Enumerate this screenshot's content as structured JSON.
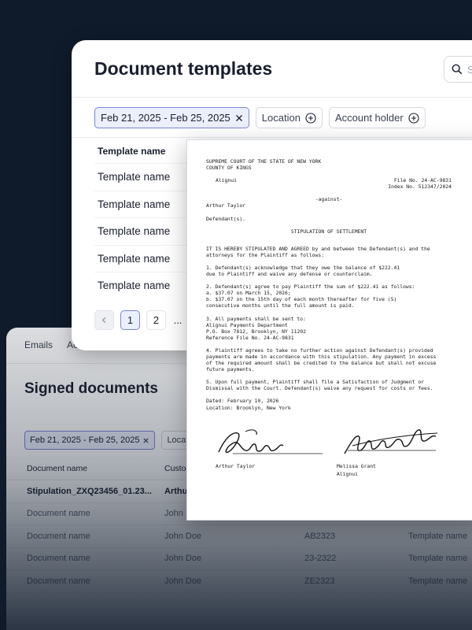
{
  "back_panel": {
    "tabs": [
      "Emails",
      "Ac"
    ],
    "title": "Signed documents",
    "filters": {
      "date_range": "Feb 21, 2025 - Feb 25, 2025",
      "location": "Location"
    },
    "columns": [
      "Document name",
      "Custo",
      "",
      ""
    ],
    "rows": [
      {
        "name": "Stipulation_ZXQ23456_01.23...",
        "customer": "Arthu",
        "id": "",
        "template": ""
      },
      {
        "name": "Document name",
        "customer": "John",
        "id": "",
        "template": ""
      },
      {
        "name": "Document name",
        "customer": "John Doe",
        "id": "AB2323",
        "template": "Template name"
      },
      {
        "name": "Document name",
        "customer": "John Doe",
        "id": "23-2322",
        "template": "Template name"
      },
      {
        "name": "Document name",
        "customer": "John Doe",
        "id": "ZE2323",
        "template": "Template name"
      }
    ]
  },
  "front_panel": {
    "title": "Document templates",
    "search_placeholder": "S",
    "filters": {
      "date_range": "Feb 21, 2025 - Feb 25, 2025",
      "location": "Location",
      "account_holder": "Account holder"
    },
    "table_header": "Template name",
    "rows": [
      "Template name",
      "Template name",
      "Template name",
      "Template name",
      "Template name"
    ],
    "pagination": {
      "pages": [
        "1",
        "2"
      ],
      "ellipsis": "...",
      "current": "1"
    }
  },
  "legal_document": {
    "court_line1": "SUPREME COURT OF THE STATE OF NEW YORK",
    "court_line2": "COUNTY OF KINGS",
    "plaintiff": "Alignui",
    "file_no": "File No. 24-AC-9831",
    "index_no": "Index No. 512347/2024",
    "against": "-against-",
    "defendant_name": "Arthur Taylor",
    "defendant_label": "Defendant(s).",
    "heading": "STIPULATION OF SETTLEMENT",
    "para_intro": [
      "IT IS HEREBY STIPULATED AND AGREED by and between the Defendant(s) and the",
      "attorneys for the Plaintiff as follows:"
    ],
    "para1": [
      "1. Defendant(s) acknowledge that they owe the balance of $222.41",
      "due to Plaintiff and waive any defense or counterclaim."
    ],
    "para2": [
      "2. Defendant(s) agree to pay Plaintiff the sum of $222.41 as follows:",
      "a. $37.07 on March 15, 2026;",
      "b. $37.07 on the 15th day of each month thereafter for five (5)",
      "consecutive months until the full amount is paid."
    ],
    "para3": [
      "3. All payments shall be sent to:",
      "Alignui Payments Department",
      "P.O. Box 7812, Brooklyn, NY 11202",
      "Reference File No. 24-AC-9831"
    ],
    "para4": [
      "4. Plaintiff agrees to take no further action against Defendant(s) provided",
      "payments are made in accordance with this stipulation. Any payment in excess",
      "of the required amount shall be credited to the balance but shall not excuse",
      "future payments."
    ],
    "para5": [
      "5. Upon full payment, Plaintiff shall file a Satisfaction of Judgment or",
      "Dismissal with the Court. Defendant(s) waive any request for costs or fees."
    ],
    "dated": "Dated: February 10, 2026",
    "location": "Location: Brooklyn, New York",
    "signer1": "Arthur Taylor",
    "signer2_name": "Melissa Grant",
    "signer2_org": "Alignui"
  },
  "colors": {
    "background": "#0f1a2b",
    "accent": "#7d86d6",
    "accent_bg": "#eceffd",
    "alert_dot": "#d63a3a"
  }
}
